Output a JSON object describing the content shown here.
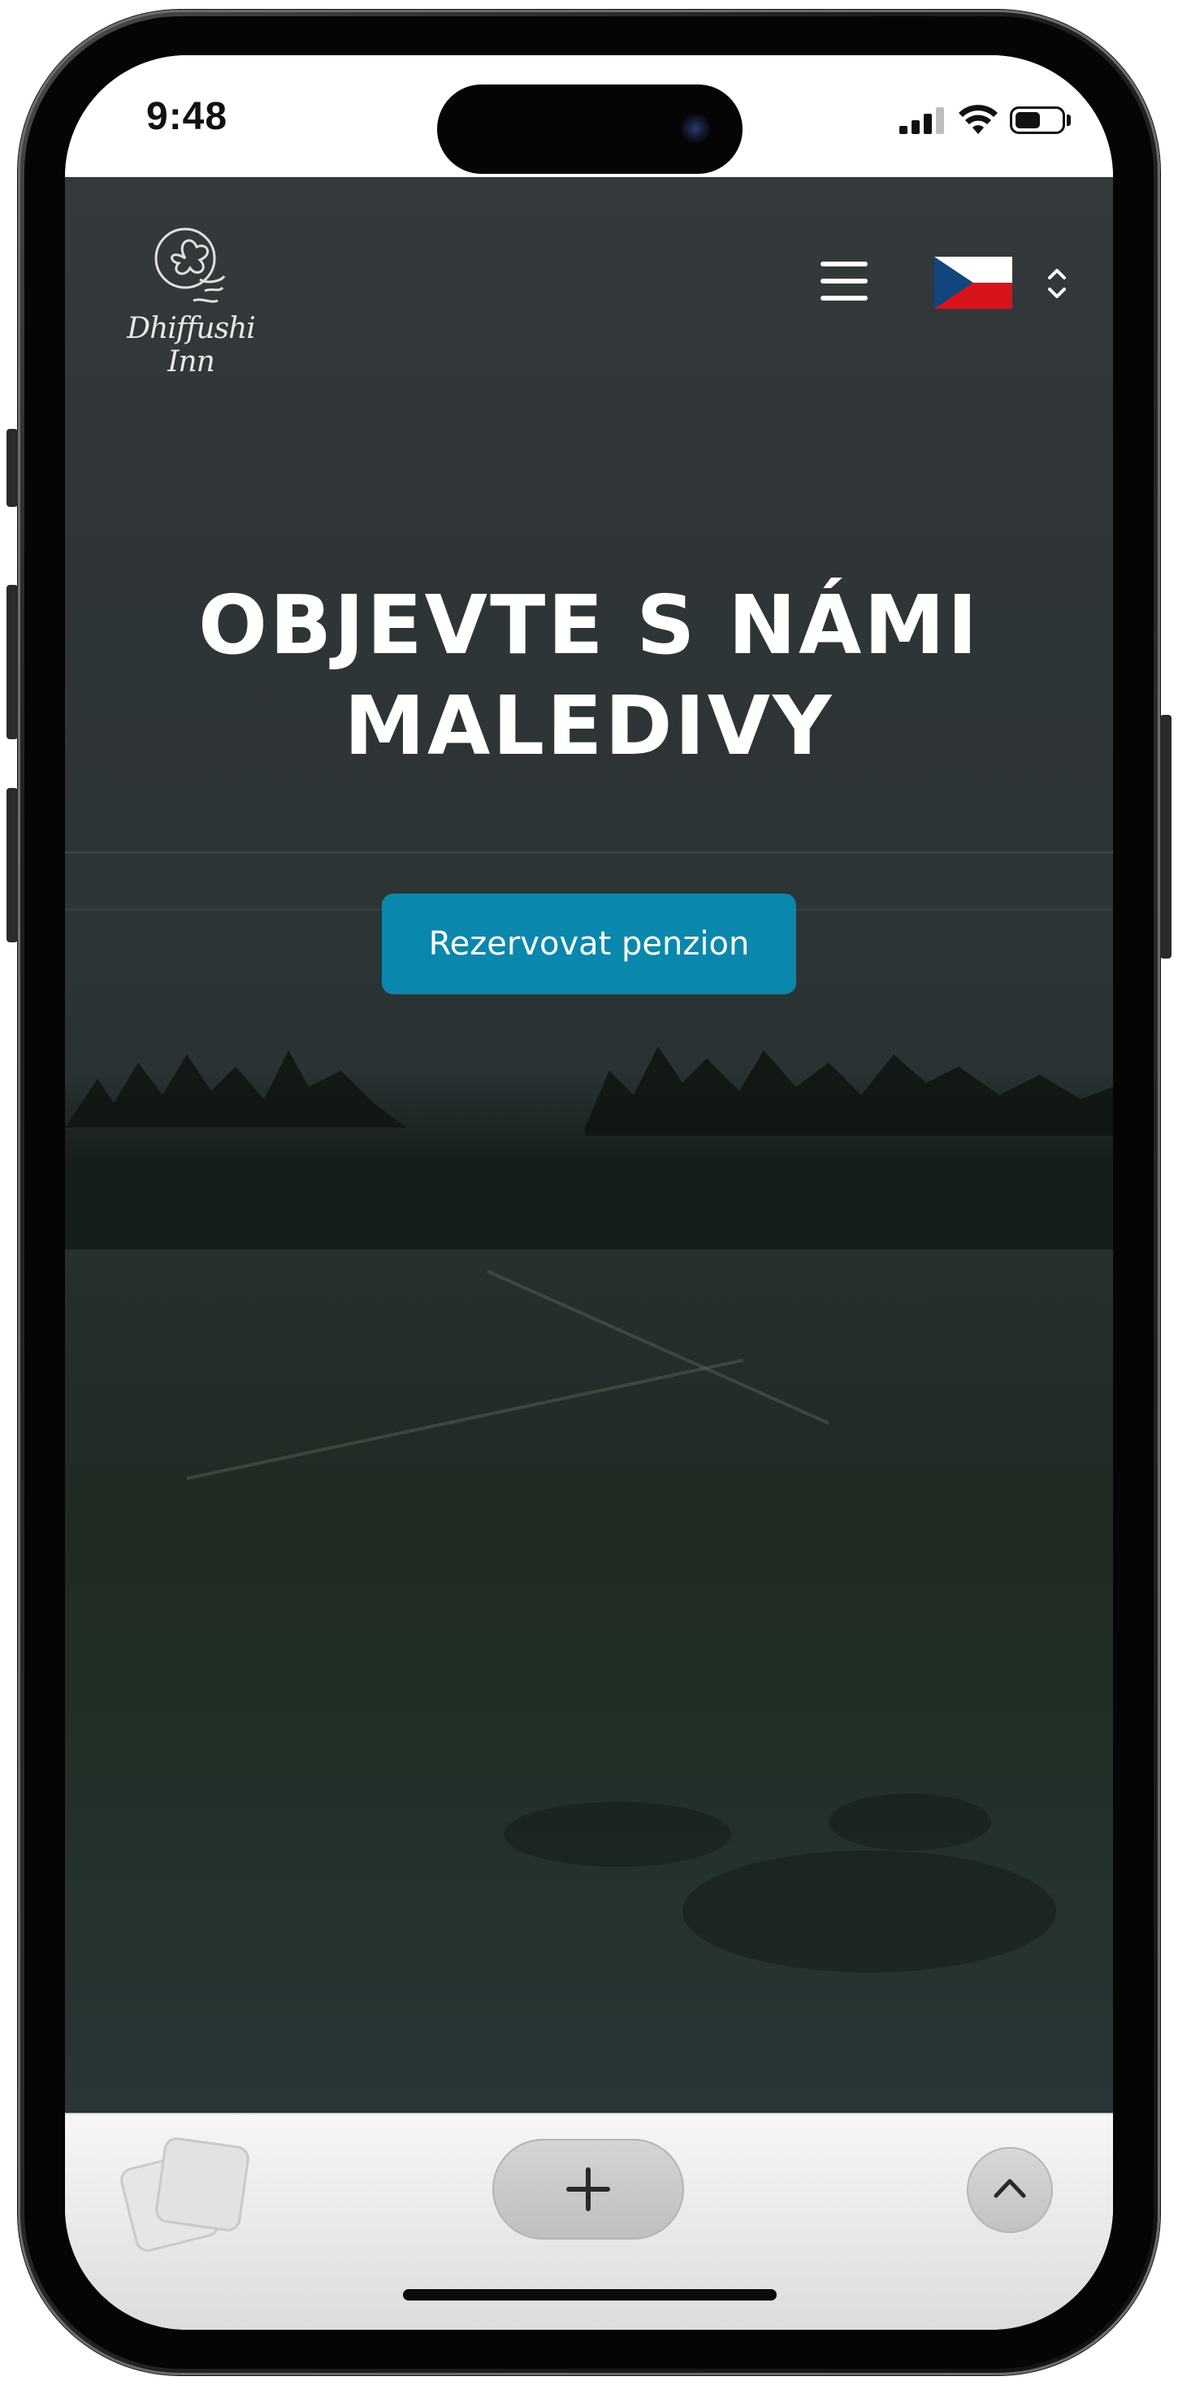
{
  "status_bar": {
    "time": "9:48",
    "battery_level": 0.55
  },
  "header": {
    "brand_name": "Dhiffushi Inn",
    "menu_icon": "hamburger-icon",
    "language": {
      "flag_icon": "czech-flag-icon",
      "selector_icon": "chevron-up-down-icon"
    }
  },
  "hero": {
    "headline_line1": "OBJEVTE S NÁMI",
    "headline_line2": "MALEDIVY",
    "cta_label": "Rezervovat penzion"
  },
  "browser_bar": {
    "tabs_icon": "tabs-icon",
    "new_tab_icon": "plus-icon",
    "up_icon": "chevron-up-icon"
  },
  "colors": {
    "cta": "#0a87ad",
    "flag_blue": "#11457e",
    "flag_red": "#d7141a",
    "flag_white": "#ffffff"
  }
}
